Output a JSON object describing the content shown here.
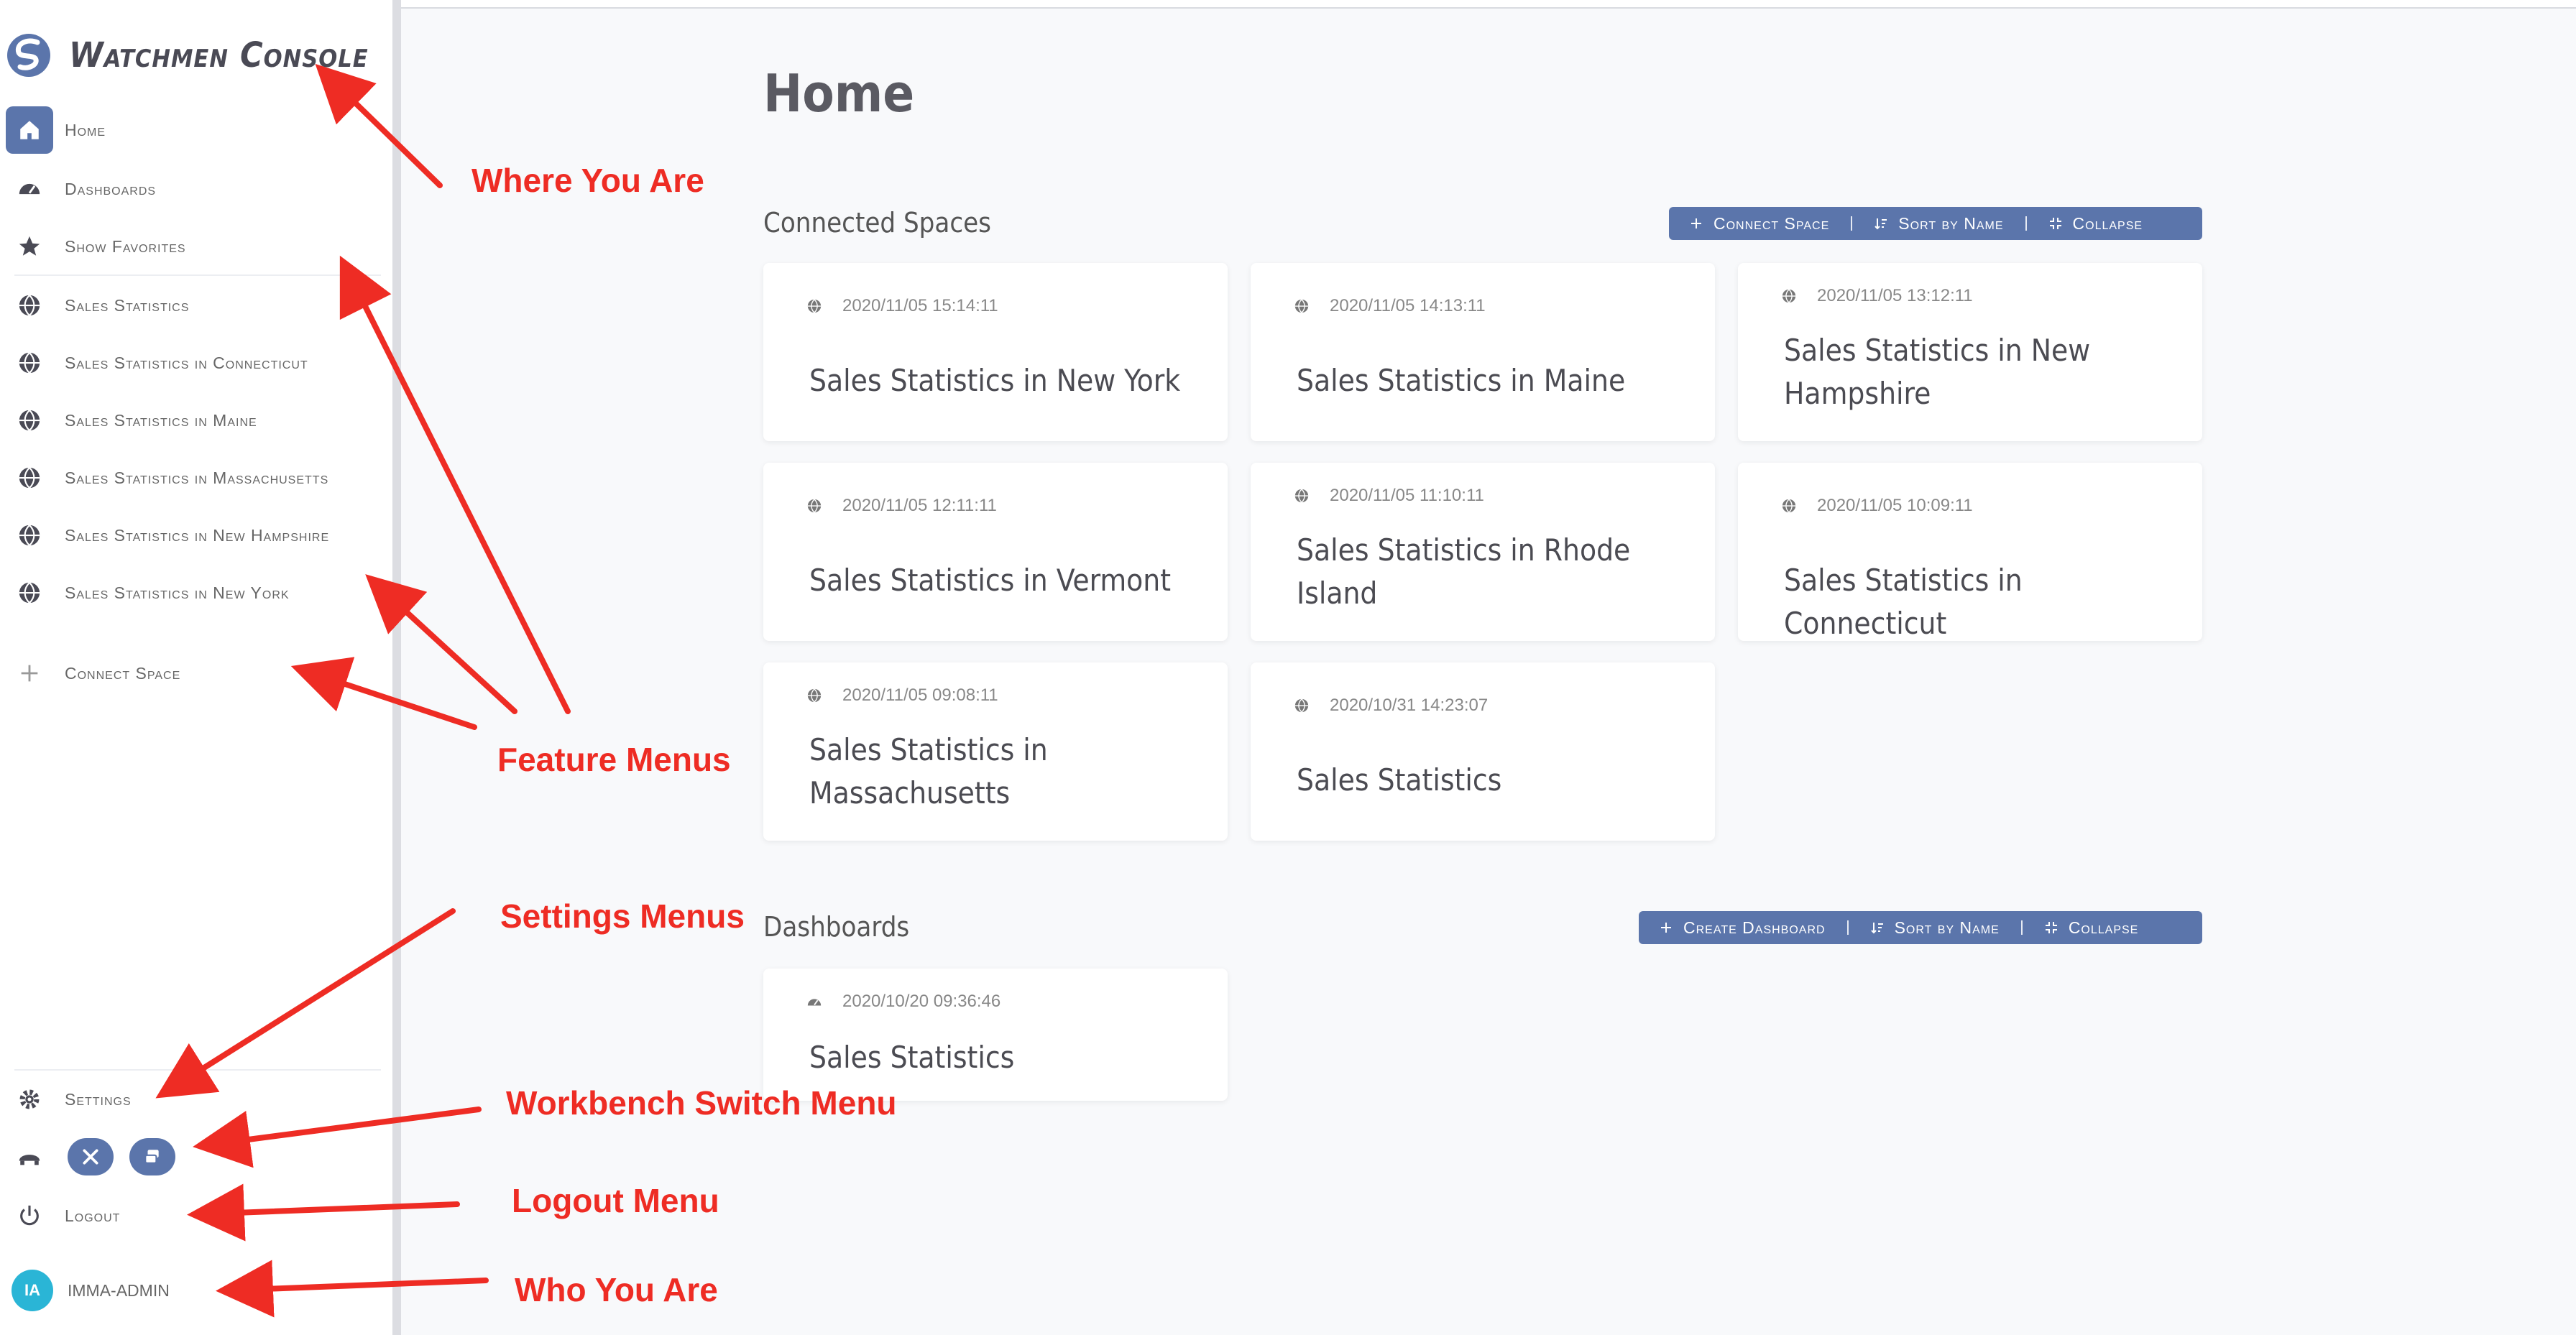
{
  "app": {
    "title": "Watchmen Console"
  },
  "sidebar": {
    "items": [
      {
        "label": "Home",
        "icon": "home-icon",
        "active": true
      },
      {
        "label": "Dashboards",
        "icon": "gauge-icon"
      },
      {
        "label": "Show Favorites",
        "icon": "star-icon"
      },
      {
        "label": "Sales Statistics",
        "icon": "globe-icon"
      },
      {
        "label": "Sales Statistics in Connecticut",
        "icon": "globe-icon"
      },
      {
        "label": "Sales Statistics in Maine",
        "icon": "globe-icon"
      },
      {
        "label": "Sales Statistics in Massachusetts",
        "icon": "globe-icon"
      },
      {
        "label": "Sales Statistics in New Hampshire",
        "icon": "globe-icon"
      },
      {
        "label": "Sales Statistics in New York",
        "icon": "globe-icon"
      },
      {
        "label": "Connect Space",
        "icon": "plus-icon"
      }
    ],
    "settings_label": "Settings",
    "logout_label": "Logout",
    "user": {
      "name": "IMMA-ADMIN",
      "initials": "IA"
    }
  },
  "main": {
    "page_title": "Home",
    "connected_spaces": {
      "title": "Connected Spaces",
      "buttons": {
        "connect": "Connect Space",
        "sort": "Sort by Name",
        "collapse": "Collapse"
      },
      "cards": [
        {
          "time": "2020/11/05 15:14:11",
          "name": "Sales Statistics in New York"
        },
        {
          "time": "2020/11/05 14:13:11",
          "name": "Sales Statistics in Maine"
        },
        {
          "time": "2020/11/05 13:12:11",
          "name": "Sales Statistics in New Hampshire"
        },
        {
          "time": "2020/11/05 12:11:11",
          "name": "Sales Statistics in Vermont"
        },
        {
          "time": "2020/11/05 11:10:11",
          "name": "Sales Statistics in Rhode Island"
        },
        {
          "time": "2020/11/05 10:09:11",
          "name": "Sales Statistics in Connecticut"
        },
        {
          "time": "2020/11/05 09:08:11",
          "name": "Sales Statistics in Massachusetts"
        },
        {
          "time": "2020/10/31 14:23:07",
          "name": "Sales Statistics"
        }
      ]
    },
    "dashboards": {
      "title": "Dashboards",
      "buttons": {
        "create": "Create Dashboard",
        "sort": "Sort by Name",
        "collapse": "Collapse"
      },
      "cards": [
        {
          "time": "2020/10/20 09:36:46",
          "name": "Sales Statistics"
        }
      ]
    }
  },
  "annotations": {
    "where": "Where You Are",
    "feature": "Feature Menus",
    "settings": "Settings Menus",
    "workbench": "Workbench Switch Menu",
    "logout": "Logout Menu",
    "who": "Who You Are"
  },
  "colors": {
    "accent": "#5b75ab",
    "annotation": "#ee2c24",
    "avatar": "#2ab5d6"
  }
}
